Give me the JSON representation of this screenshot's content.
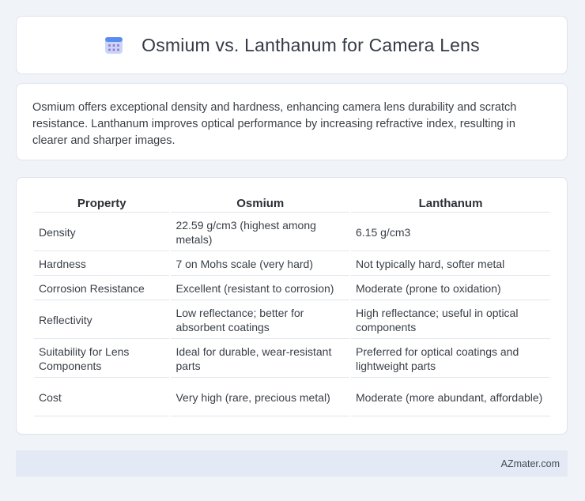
{
  "header": {
    "title": "Osmium vs. Lanthanum for Camera Lens",
    "icon": "calendar-grid-icon"
  },
  "summary": {
    "text": "Osmium offers exceptional density and hardness, enhancing camera lens durability and scratch resistance. Lanthanum improves optical performance by increasing refractive index, resulting in clearer and sharper images."
  },
  "table": {
    "headers": [
      "Property",
      "Osmium",
      "Lanthanum"
    ],
    "rows": [
      [
        "Density",
        "22.59 g/cm3 (highest among metals)",
        "6.15 g/cm3"
      ],
      [
        "Hardness",
        "7 on Mohs scale (very hard)",
        "Not typically hard, softer metal"
      ],
      [
        "Corrosion Resistance",
        "Excellent (resistant to corrosion)",
        "Moderate (prone to oxidation)"
      ],
      [
        "Reflectivity",
        "Low reflectance; better for absorbent coatings",
        "High reflectance; useful in optical components"
      ],
      [
        "Suitability for Lens Components",
        "Ideal for durable, wear-resistant parts",
        "Preferred for optical coatings and lightweight parts"
      ],
      [
        "Cost",
        "Very high (rare, precious metal)",
        "Moderate (more abundant, affordable)"
      ]
    ]
  },
  "footer": {
    "text": "AZmater.com"
  },
  "colors": {
    "background": "#f0f3f8",
    "card": "#ffffff",
    "footer_bg": "#e4eaf5",
    "icon_blue": "#5b8def",
    "icon_purple": "#9b7fd6"
  }
}
